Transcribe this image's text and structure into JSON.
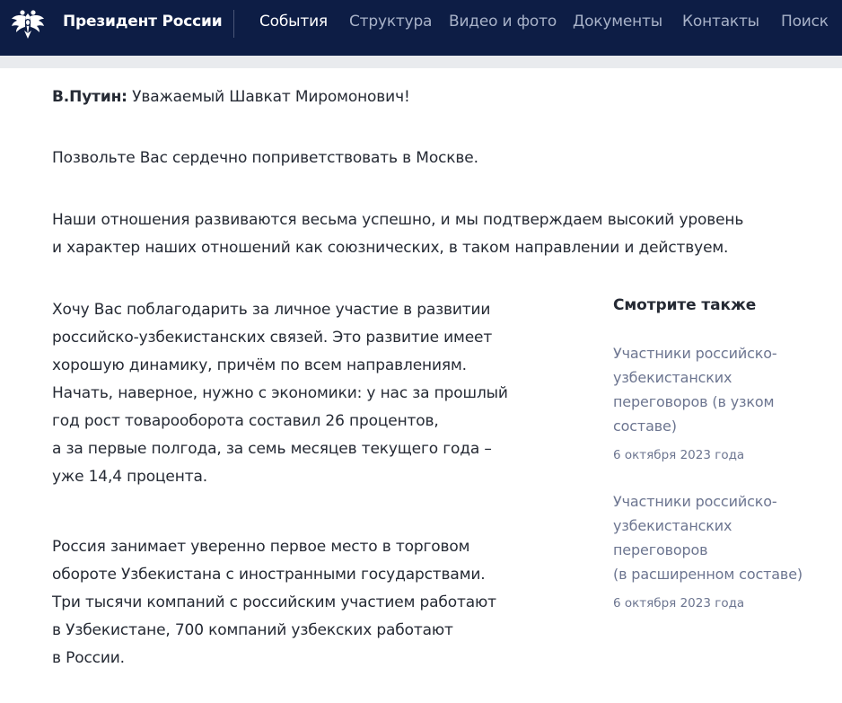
{
  "header": {
    "brand": "Президент России",
    "nav": [
      {
        "label": "События",
        "active": true
      },
      {
        "label": "Структура",
        "active": false
      },
      {
        "label": "Видео и фото",
        "active": false
      },
      {
        "label": "Документы",
        "active": false
      },
      {
        "label": "Контакты",
        "active": false
      },
      {
        "label": "Поиск",
        "active": false
      }
    ]
  },
  "article": {
    "p1_speaker": "В.Путин:",
    "p1_text": "Уважаемый Шавкат Миромонович!",
    "p2": "Позвольте Вас сердечно поприветствовать в Москве.",
    "p3_lines": [
      "Наши отношения развиваются весьма успешно, и мы подтверждаем высокий уровень",
      "и характер наших отношений как союзнических, в таком направлении и действуем."
    ],
    "p4_lines": [
      "Хочу Вас поблагодарить за личное участие в развитии",
      "российско-узбекистанских связей. Это развитие имеет",
      "хорошую динамику, причём по всем направлениям.",
      "Начать, наверное, нужно с экономики: у нас за прошлый",
      "год рост товарооборота составил 26 процентов,",
      "а за первые полгода, за семь месяцев текущего года –",
      "уже 14,4 процента."
    ],
    "p5_lines": [
      "Россия занимает уверенно первое место в торговом",
      "обороте Узбекистана с иностранными государствами.",
      "Три тысячи компаний с российским участием работают",
      "в Узбекистане, 700 компаний узбекских работают",
      "в России."
    ]
  },
  "see_also": {
    "title": "Смотрите также",
    "items": [
      {
        "title_lines": [
          "Участники российско-",
          "узбекистанских",
          "переговоров (в узком",
          "составе)"
        ],
        "date": "6 октября 2023 года"
      },
      {
        "title_lines": [
          "Участники российско-",
          "узбекистанских",
          "переговоров",
          "(в расширенном составе)"
        ],
        "date": "6 октября 2023 года"
      }
    ]
  }
}
